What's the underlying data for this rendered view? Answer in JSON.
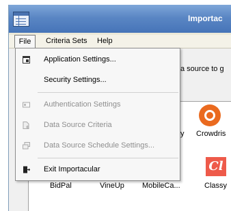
{
  "window": {
    "title": "Importac"
  },
  "menubar": {
    "items": [
      {
        "label": "File"
      },
      {
        "label": "Criteria Sets"
      },
      {
        "label": "Help"
      }
    ]
  },
  "content": {
    "hint_text": "a source to g",
    "grid": [
      {
        "label": "y"
      },
      {
        "label": "Crowdris"
      },
      {
        "label": "BidPal"
      },
      {
        "label": "VineUp"
      },
      {
        "label": "MobileCa..."
      },
      {
        "label": "Classy"
      }
    ],
    "icons": {
      "crowdrise": "crowdrise-logo-icon",
      "classy": "classy-logo-icon",
      "classy_glyph": "Cl"
    },
    "colors": {
      "crowdrise": "#ea6a1f",
      "classy": "#ee5a4a",
      "titlebar": "#5a86c4"
    }
  },
  "file_menu": {
    "items": [
      {
        "label": "Application Settings...",
        "enabled": true,
        "icon": "window-icon"
      },
      {
        "label": "Security Settings...",
        "enabled": true,
        "icon": ""
      },
      {
        "label": "Authentication Settings",
        "enabled": false,
        "icon": "id-card-icon"
      },
      {
        "label": "Data Source Criteria",
        "enabled": false,
        "icon": "document-gear-icon"
      },
      {
        "label": "Data Source Schedule Settings...",
        "enabled": false,
        "icon": "windows-icon"
      },
      {
        "label": "Exit Importacular",
        "enabled": true,
        "icon": "exit-door-icon"
      }
    ]
  }
}
